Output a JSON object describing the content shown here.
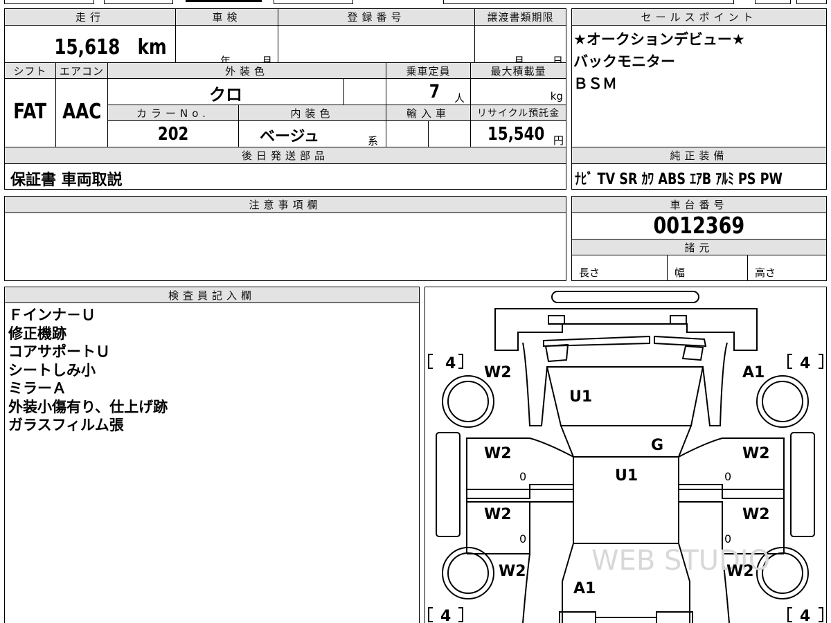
{
  "mileage": {
    "label": "走行",
    "value": "15,618",
    "unit": "km"
  },
  "inspection": {
    "label": "車検",
    "year_unit": "年",
    "month_unit": "月"
  },
  "registration": {
    "label": "登録番号",
    "value": ""
  },
  "transfer_deadline": {
    "label": "譲渡書類期限",
    "month_unit": "月",
    "day_unit": "日"
  },
  "sales_points": {
    "label": "セールスポイント",
    "lines": [
      "★オークションデビュー★",
      "バックモニター",
      "ＢＳＭ"
    ]
  },
  "shift": {
    "label": "シフト",
    "value": "FAT"
  },
  "aircon": {
    "label": "エアコン",
    "value": "AAC"
  },
  "exterior_color": {
    "label": "外装色",
    "value": "クロ"
  },
  "capacity": {
    "label": "乗車定員",
    "value": "7",
    "unit": "人"
  },
  "max_load": {
    "label": "最大積載量",
    "unit": "kg"
  },
  "color_no": {
    "label": "カラーNo.",
    "value": "202"
  },
  "interior_color": {
    "label": "内装色",
    "value": "ベージュ",
    "suffix": "系"
  },
  "import": {
    "label": "輸入車"
  },
  "recycle": {
    "label": "リサイクル預託金",
    "value": "15,540",
    "unit": "円"
  },
  "later_parts": {
    "label": "後日発送部品",
    "value": "保証書 車両取説"
  },
  "genuine_equipment": {
    "label": "純正装備",
    "value": "ﾅﾋﾞ TV SR ｶﾜ ABS ｴｱB ｱﾙﾐ PS PW"
  },
  "caution": {
    "label": "注意事項欄"
  },
  "chassis": {
    "label": "車台番号",
    "value": "0012369"
  },
  "specs": {
    "label": "諸元",
    "length": "長さ",
    "width": "幅",
    "height": "高さ"
  },
  "inspector": {
    "label": "検査員記入欄",
    "lines": [
      "Ｆインナ－Ｕ",
      "修正機跡",
      "コアサポートＵ",
      "シートしみ小",
      "ミラーＡ",
      "外装小傷有り、仕上げ跡",
      "ガラスフィルム張"
    ]
  },
  "diagram": {
    "tires": {
      "front_left": "4",
      "front_right": "4",
      "rear_left": "4",
      "rear_right": "4"
    },
    "marks": {
      "front_left_fender": "W2",
      "front_right_fender": "A1",
      "windshield": "U1",
      "roof_glass": "G",
      "roof": "U1",
      "left_front_door": "W2",
      "right_front_door": "W2",
      "left_rear_door": "W2",
      "right_rear_door": "W2",
      "left_rear_quarter": "W2",
      "right_rear_quarter": "W2",
      "rear": "A1",
      "lf_door_zero": "0",
      "rf_door_zero": "0",
      "lr_door_zero": "0",
      "rr_door_zero": "0"
    },
    "watermark": "WEB STUDIO"
  }
}
